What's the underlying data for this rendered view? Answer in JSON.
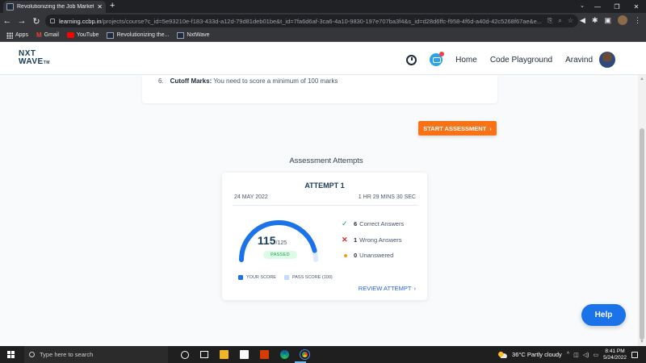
{
  "browser": {
    "tab_title": "Revolutionizing the Job Market |",
    "tab_close": "✕",
    "new_tab": "+",
    "url_host": "learning.ccbp.in",
    "url_path": "/projects/course?c_id=5e93210e-f183-433d-a12d-79d81deb01be&t_id=7fa6d6af-3ca6-4a10-9830-197e707ba3f4&s_id=d28d6ffc-f958-4f6d-a40d-42c5268f67ae&e...",
    "bookmarks": [
      {
        "label": "Apps"
      },
      {
        "label": "Gmail"
      },
      {
        "label": "YouTube"
      },
      {
        "label": "Revolutionizing the..."
      },
      {
        "label": "NxtWave"
      }
    ]
  },
  "header": {
    "logo_line1": "NXT",
    "logo_line2": "WAVE",
    "logo_tm": "TM",
    "nav_home": "Home",
    "nav_code_playground": "Code Playground",
    "user_name": "Aravind"
  },
  "instructions": {
    "number": "6.",
    "label": "Cutoff Marks:",
    "text": " You need to score a minimum of 100 marks"
  },
  "start_button": "START ASSESSMENT",
  "attempts_title": "Assessment Attempts",
  "attempt": {
    "name": "ATTEMPT 1",
    "date": "24 MAY 2022",
    "duration": "1 HR 29 MINS 30 SEC",
    "score": "115",
    "total": "/125",
    "score_value": 115,
    "max_score": 125,
    "status": "PASSED",
    "correct_count": "6",
    "correct_label": "Correct Answers",
    "wrong_count": "1",
    "wrong_label": "Wrong Answers",
    "unanswered_count": "0",
    "unanswered_label": "Unanswered",
    "legend_your_score": "YOUR SCORE",
    "legend_pass_score": "PASS SCORE (100)",
    "review_label": "REVIEW ATTEMPT"
  },
  "help_button": "Help",
  "taskbar": {
    "search_placeholder": "Type here to search",
    "weather": "36°C  Partly cloudy",
    "time": "8:41 PM",
    "date": "5/24/2022"
  },
  "colors": {
    "accent_orange": "#f97316",
    "accent_blue": "#1a73e8",
    "brand_navy": "#183b56",
    "pass_green": "#16a34a"
  }
}
